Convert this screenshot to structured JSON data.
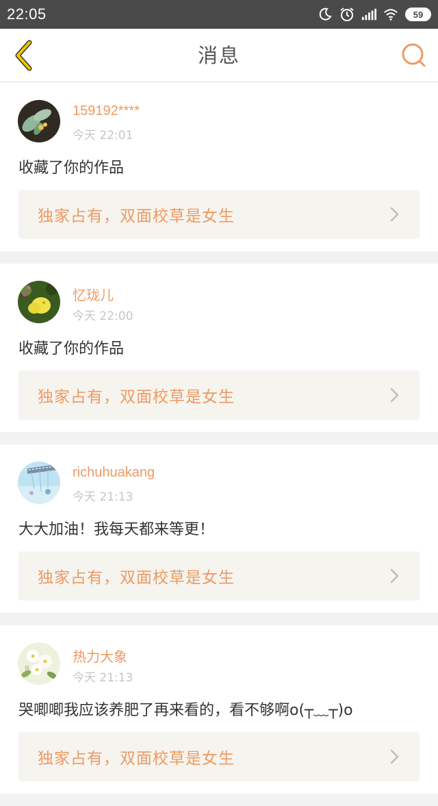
{
  "status_bar": {
    "time": "22:05",
    "battery": "59",
    "icons": [
      "moon-icon",
      "alarm-icon",
      "signal-icon",
      "wifi-icon",
      "battery-icon"
    ]
  },
  "header": {
    "title": "消息",
    "back_icon": "chevron-left-icon",
    "search_icon": "search-icon"
  },
  "colors": {
    "accent": "#ee9a62",
    "back_icon": "#e8b800",
    "status_bar_bg": "#4a4a4a",
    "card_link_bg": "#f5f4ef"
  },
  "messages": [
    {
      "user": "159192****",
      "time": "今天 22:01",
      "text": "收藏了你的作品",
      "work": "独家占有，双面校草是女生",
      "avatar": "succulent-plant-avatar"
    },
    {
      "user": "忆珑儿",
      "time": "今天 22:00",
      "text": "收藏了你的作品",
      "work": "独家占有，双面校草是女生",
      "avatar": "yellow-butterfly-avatar"
    },
    {
      "user": "richuhuakang",
      "time": "今天 21:13",
      "text": "大大加油！我每天都来等更！",
      "work": "独家占有，双面校草是女生",
      "avatar": "sky-bridge-avatar"
    },
    {
      "user": "热力大象",
      "time": "今天 21:13",
      "text": "哭唧唧我应该养肥了再来看的，看不够啊o(┬﹏┬)o",
      "work": "独家占有，双面校草是女生",
      "avatar": "white-flowers-avatar"
    }
  ]
}
